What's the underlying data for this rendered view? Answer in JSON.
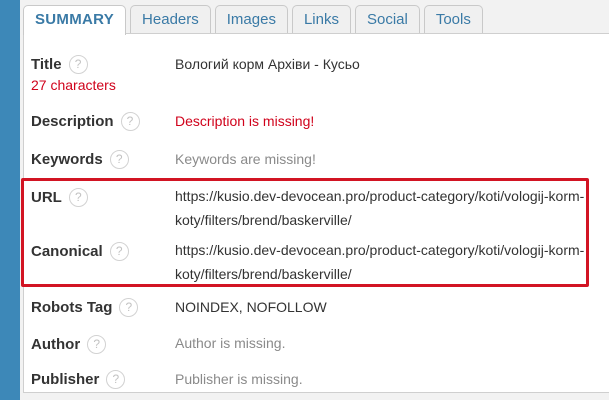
{
  "tabs": [
    {
      "label": "SUMMARY"
    },
    {
      "label": "Headers"
    },
    {
      "label": "Images"
    },
    {
      "label": "Links"
    },
    {
      "label": "Social"
    },
    {
      "label": "Tools"
    }
  ],
  "help_glyph": "?",
  "rows": {
    "title": {
      "label": "Title",
      "sub": "27 characters",
      "value": "Вологий корм Архіви - Кусьо"
    },
    "description": {
      "label": "Description",
      "value": "Description is missing!"
    },
    "keywords": {
      "label": "Keywords",
      "value": "Keywords are missing!"
    },
    "url": {
      "label": "URL",
      "value": "https://kusio.dev-devocean.pro/product-category/koti/vologij-korm-koty/filters/brend/baskerville/"
    },
    "canonical": {
      "label": "Canonical",
      "value": "https://kusio.dev-devocean.pro/product-category/koti/vologij-korm-koty/filters/brend/baskerville/"
    },
    "robots": {
      "label": "Robots Tag",
      "value": "NOINDEX, NOFOLLOW"
    },
    "author": {
      "label": "Author",
      "value": "Author is missing."
    },
    "publisher": {
      "label": "Publisher",
      "value": "Publisher is missing."
    }
  },
  "colors": {
    "accent": "#3a7aa6",
    "error": "#d0021b",
    "highlight_border": "#d21423",
    "background": "#3d88b8"
  }
}
